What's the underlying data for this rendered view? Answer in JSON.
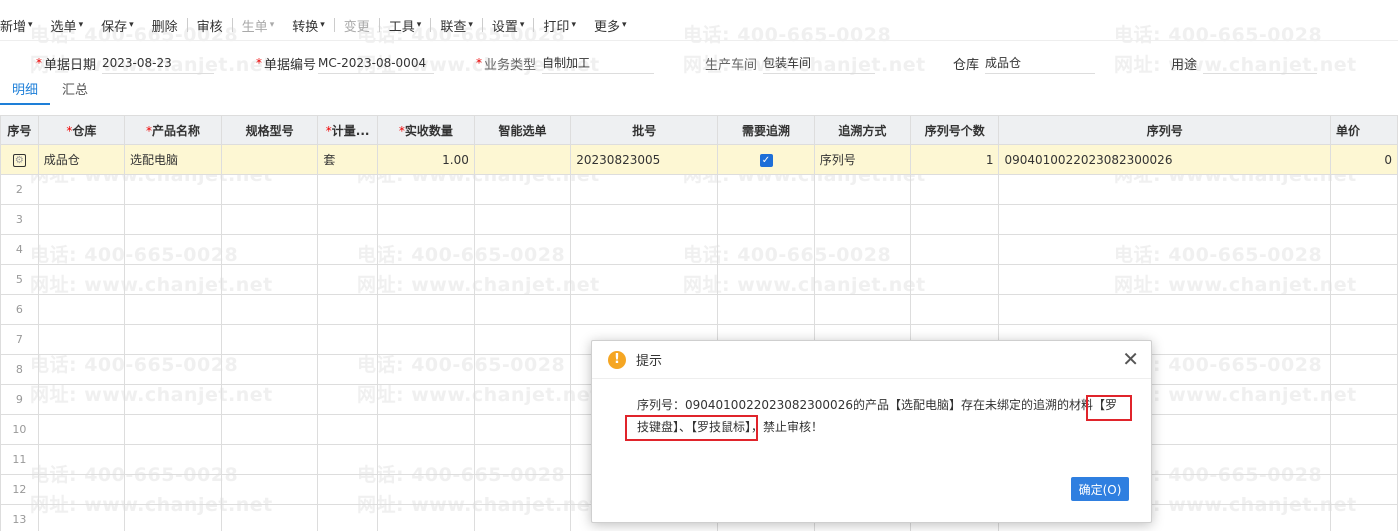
{
  "toolbar": {
    "items": [
      {
        "label": "新增",
        "caret": "▾"
      },
      {
        "label": "选单",
        "caret": "▾"
      },
      {
        "label": "保存",
        "caret": "▾"
      },
      {
        "label": "删除",
        "caret": ""
      },
      {
        "label": "审核",
        "caret": ""
      },
      {
        "label": "生单",
        "caret": "▾"
      },
      {
        "label": "转换",
        "caret": "▾"
      },
      {
        "label": "变更",
        "caret": ""
      },
      {
        "label": "工具",
        "caret": "▾"
      },
      {
        "label": "联查",
        "caret": "▾"
      },
      {
        "label": "设置",
        "caret": "▾"
      },
      {
        "label": "打印",
        "caret": "▾"
      },
      {
        "label": "更多",
        "caret": "▾"
      }
    ]
  },
  "form": {
    "date": {
      "required": "*",
      "label": "单据日期",
      "value": "2023-08-23"
    },
    "code": {
      "required": "*",
      "label": "单据编号",
      "value": "MC-2023-08-0004"
    },
    "biz_type": {
      "required": "*",
      "label": "业务类型",
      "value": "自制加工"
    },
    "workshop": {
      "label": "生产车间",
      "value": "包装车间"
    },
    "warehouse": {
      "label": "仓库",
      "value": "成品仓"
    },
    "purpose": {
      "label": "用途",
      "value": ""
    }
  },
  "tabs": {
    "detail": "明细",
    "summary": "汇总"
  },
  "grid": {
    "headers": {
      "rownum": "序号",
      "warehouse": "仓库",
      "product": "产品名称",
      "spec": "规格型号",
      "unit": "计量...",
      "qty": "实收数量",
      "smart": "智能选单",
      "batch": "批号",
      "trace": "需要追溯",
      "trace_method": "追溯方式",
      "sn_count": "序列号个数",
      "sn": "序列号",
      "price": "单价"
    },
    "required_mark": "*",
    "row1": {
      "warehouse": "成品仓",
      "product": "选配电脑",
      "spec": "",
      "unit": "套",
      "qty": "1.00",
      "smart": "",
      "batch": "20230823005",
      "trace_checked": true,
      "trace_method": "序列号",
      "sn_count": "1",
      "sn": "090401002202308230​0026",
      "price": "0"
    },
    "row_numbers": [
      "2",
      "3",
      "4",
      "5",
      "6",
      "7",
      "8",
      "9",
      "10",
      "11",
      "12",
      "13"
    ]
  },
  "watermark": {
    "phone": "电话: 400-665-0028",
    "site": "网址: www.chanjet.net"
  },
  "dialog": {
    "title": "提示",
    "close": "✕",
    "icon": "!",
    "message": "序列号：0904010022023082300026的产品【选配电脑】存在未绑定的追溯的材料【罗技键盘】、【罗技鼠标】，禁止审核！",
    "ok": "确定(O)"
  },
  "colors": {
    "accent": "#2f7fe0",
    "highlight_box": "#e0242b",
    "selected_row": "#fdf7d3",
    "warning": "#f5a623"
  }
}
